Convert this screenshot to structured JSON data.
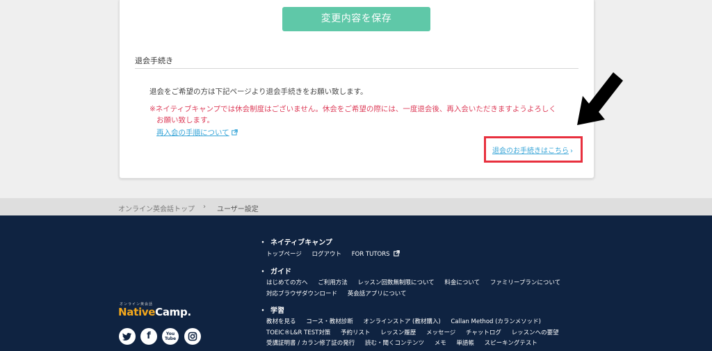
{
  "card": {
    "save_button": "変更内容を保存",
    "section_title": "退会手続き",
    "line1": "退会をご希望の方は下記ページより退会手続きをお願い致します。",
    "warning_line1": "※ネイティブキャンプでは休会制度はございません。休会をご希望の際には、一度退会後、再入会いただきますようよろしく",
    "warning_line2": "お願い致します。",
    "rejoin_link": "再入会の手順について",
    "withdraw_link": "退会のお手続きはこちら",
    "withdraw_chevron": "›"
  },
  "breadcrumb": {
    "home": "オンライン英会話トップ",
    "separator": "›",
    "current": "ユーザー設定"
  },
  "footer": {
    "logo_small": "オンライン英会話",
    "logo_native": "Native",
    "logo_camp": "Camp.",
    "bullet": "・",
    "sections": [
      {
        "title": "ネイティブキャンプ",
        "rows": [
          [
            "トップページ",
            "ログアウト",
            "FOR TUTORS"
          ]
        ]
      },
      {
        "title": "ガイド",
        "rows": [
          [
            "はじめての方へ",
            "ご利用方法",
            "レッスン回数無制限について",
            "料金について",
            "ファミリープランについて"
          ],
          [
            "対応ブラウザダウンロード",
            "英会話アプリについて"
          ]
        ]
      },
      {
        "title": "学習",
        "rows": [
          [
            "教材を見る",
            "コース・教材診断",
            "オンラインストア (教材購入)",
            "Callan Method (カランメソッド)"
          ],
          [
            "TOEIC®L&R TEST対策",
            "予約リスト",
            "レッスン履歴",
            "メッセージ",
            "チャットログ",
            "レッスンへの要望"
          ],
          [
            "受講証明書 / カラン修了証の発行",
            "読む・聞くコンテンツ",
            "メモ",
            "単語帳",
            "スピーキングテスト"
          ]
        ]
      }
    ],
    "social": {
      "twitter": "t",
      "facebook": "f",
      "youtube": "You Tube",
      "instagram": "◎"
    }
  },
  "colors": {
    "save_button": "#5fc8a8",
    "warning": "#dd3e5a",
    "link": "#3aa6d8",
    "footer_bg": "#0f2341",
    "highlight": "#e8303e"
  }
}
